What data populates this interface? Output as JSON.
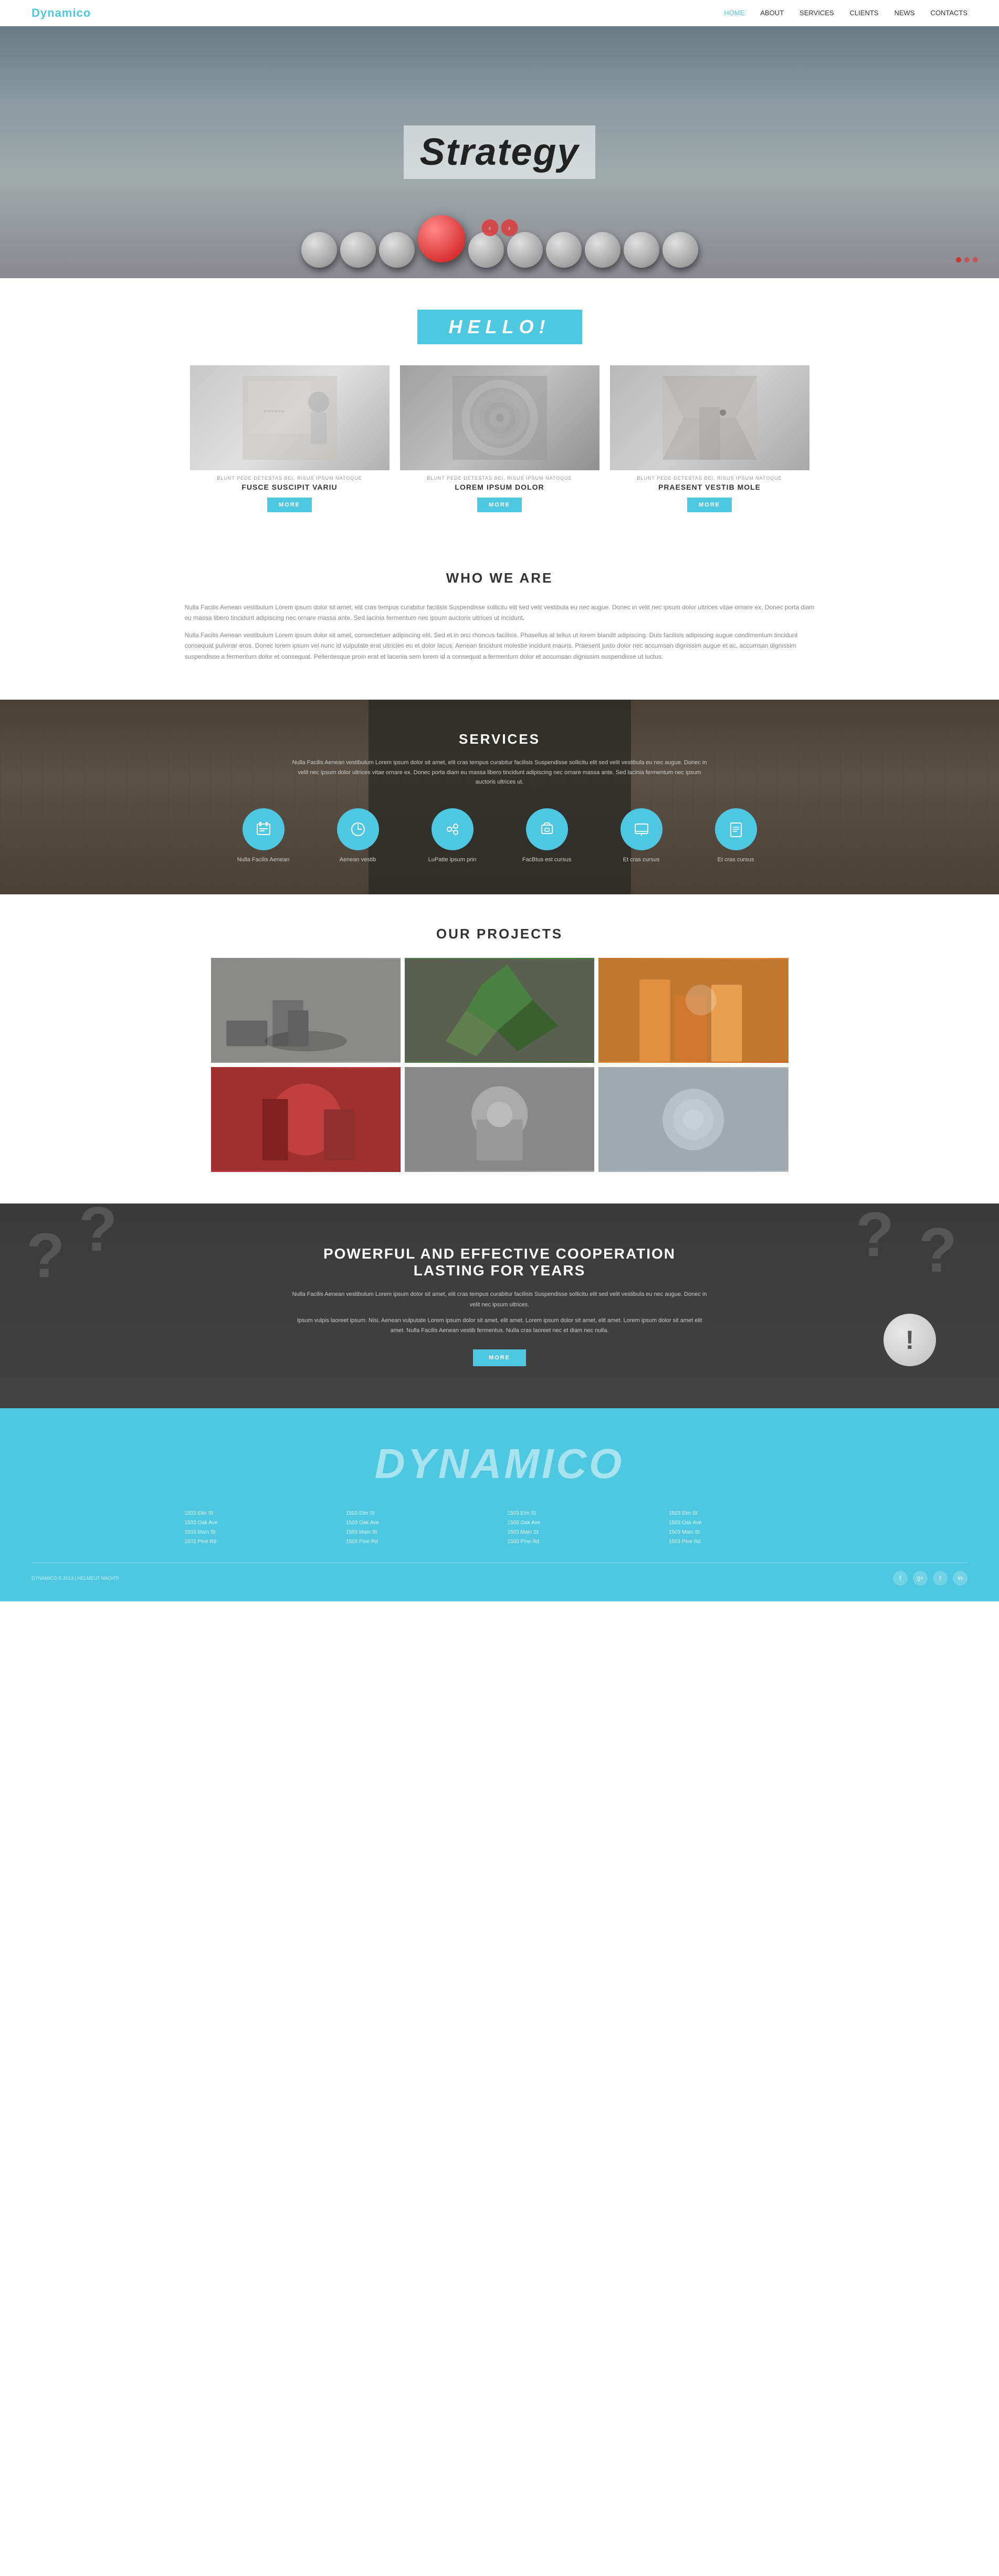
{
  "brand": {
    "name": "Dynamic",
    "name_accent": "o",
    "footer_logo": "DYNAMIC",
    "footer_logo_accent": "O"
  },
  "navbar": {
    "home_label": "Home",
    "about_label": "About",
    "services_label": "Services",
    "clients_label": "Clients",
    "news_label": "News",
    "contacts_label": "Contacts"
  },
  "hero": {
    "title": "Strategy",
    "prev_label": "‹",
    "next_label": "›"
  },
  "hello": {
    "badge_text": "HELL",
    "badge_accent": "O!",
    "cards": [
      {
        "label_small": "Blunt Pede Detestas Bei, Risus Ipsum Natoque",
        "title": "FUSCE SUSCIPIT VARIU",
        "btn_label": "MORE"
      },
      {
        "label_small": "Blunt Pede Detestas Bei, Risus Ipsum Natoque",
        "title": "LOREM IPSUM DOLOR",
        "btn_label": "MORE"
      },
      {
        "label_small": "Blunt Pede Detestas Bei, Risus Ipsum Natoque",
        "title": "PRAESENT VESTIB MOLE",
        "btn_label": "MORE"
      }
    ]
  },
  "who": {
    "title": "WHO WE ARE",
    "para1": "Nulla Facilis Aenean vestibulum Lorem ipsum dolor sit amet, elit cras tempus curabitur facilisis Suspendisse sollicitu elit sed velit vestibula eu nec augue. Donec in velit nec ipsum dolor ultrices vitae ornare ex. Donec porta diam eu massa libero tincidunt adipiscing nec ornare massa ante. Sed lacinia fermentum nec ipsum auctoris ultrices ut incidunt.",
    "para2": "Nulla Facilis Aenean vestibulum Lorem ipsum dolor sit amet, consectetuer adipiscing elit. Sed et in orci rhoncus facilisis. Phasellus at tellus ut lorem blandit adipiscing. Duis facilisis adipiscing augue condimentum tincidunt consequat pulvinar eros. Donec lorem ipsum vel nunc id vulputate erat ultricies eu et dolor lacus. Aenean tincidunt molestie incidunt mauris. Praesent justo dolor nec accumsan dignissim augue et ac, accumsan dignissim suspendisse a fermentum dolor et consequat. Pellentesque proin erat et lacenia sem lorem id a consequat a fermentum dolor et accumsan dignissim suspendisse ut luctus."
  },
  "services": {
    "title": "SERVICES",
    "desc": "Nulla Facilis Aenean vestibulum Lorem ipsum dolor sit amet, elit cras tempus curabitur facilisis Suspendisse sollicitu elit sed velit vestibula eu nec augue. Donec in velit nec ipsum dolor ultrices vitae ornare ex. Donec porta diam eu massa libero tincidunt adipiscing nec ornare massa ante. Sed lacinia fermentum nec ipsum auctoris ultrices ut.",
    "items": [
      {
        "icon": "🗃",
        "label": "Nulla Facilis Aenean"
      },
      {
        "icon": "⏰",
        "label": "Aenean vestib"
      },
      {
        "icon": "⚙",
        "label": "LuPatte ipsum prin"
      },
      {
        "icon": "📋",
        "label": "FacBtus est cursus"
      },
      {
        "icon": "🖥",
        "label": "Et cras cursus"
      },
      {
        "icon": "📄",
        "label": "Et cras cursus"
      }
    ]
  },
  "projects": {
    "title": "OUR PROJECTS"
  },
  "coop": {
    "title": "POWERFUL AND EFFECTIVE COOPERATION LASTING FOR YEARS",
    "para1": "Nulla Facilis Aenean vestibulum Lorem ipsum dolor sit amet, elit cras tempus curabitur facilisis Suspendisse sollicitu elit sed velit vestibula eu nec augue. Donec in velit nec ipsum ultrices.",
    "para2": "Ipsum vulpis laoreet ipsum. Nisi, Aenean vulputate Lorem ipsum dolor sit amet, elit amet. Lorem ipsum dolor sit amet, elit amet. Lorem ipsum dolor sit amet elit amet. Nulla Facilis Aenean vestib fermentus. Nulla cras laoreet nec et diam nec nulla.",
    "btn_label": "MORE"
  },
  "footer": {
    "col1": "1503 Elm St\n1503 Oak Ave\n1503 Main St\n1503 Pine Rd",
    "col2": "1503 Elm St\n1503 Oak Ave\n1503 Main St\n1503 Pine Rd",
    "col3": "1503 Elm St\n1503 Oak Ave\n1503 Main St\n1503 Pine Rd",
    "col4": "1503 Elm St\n1503 Oak Ave\n1503 Main St\n1503 Pine Rd",
    "copy": "DYNAMICO © 2013 | HELMEUT NACHTI",
    "social_icons": [
      "f",
      "g+",
      "t",
      "in"
    ]
  }
}
